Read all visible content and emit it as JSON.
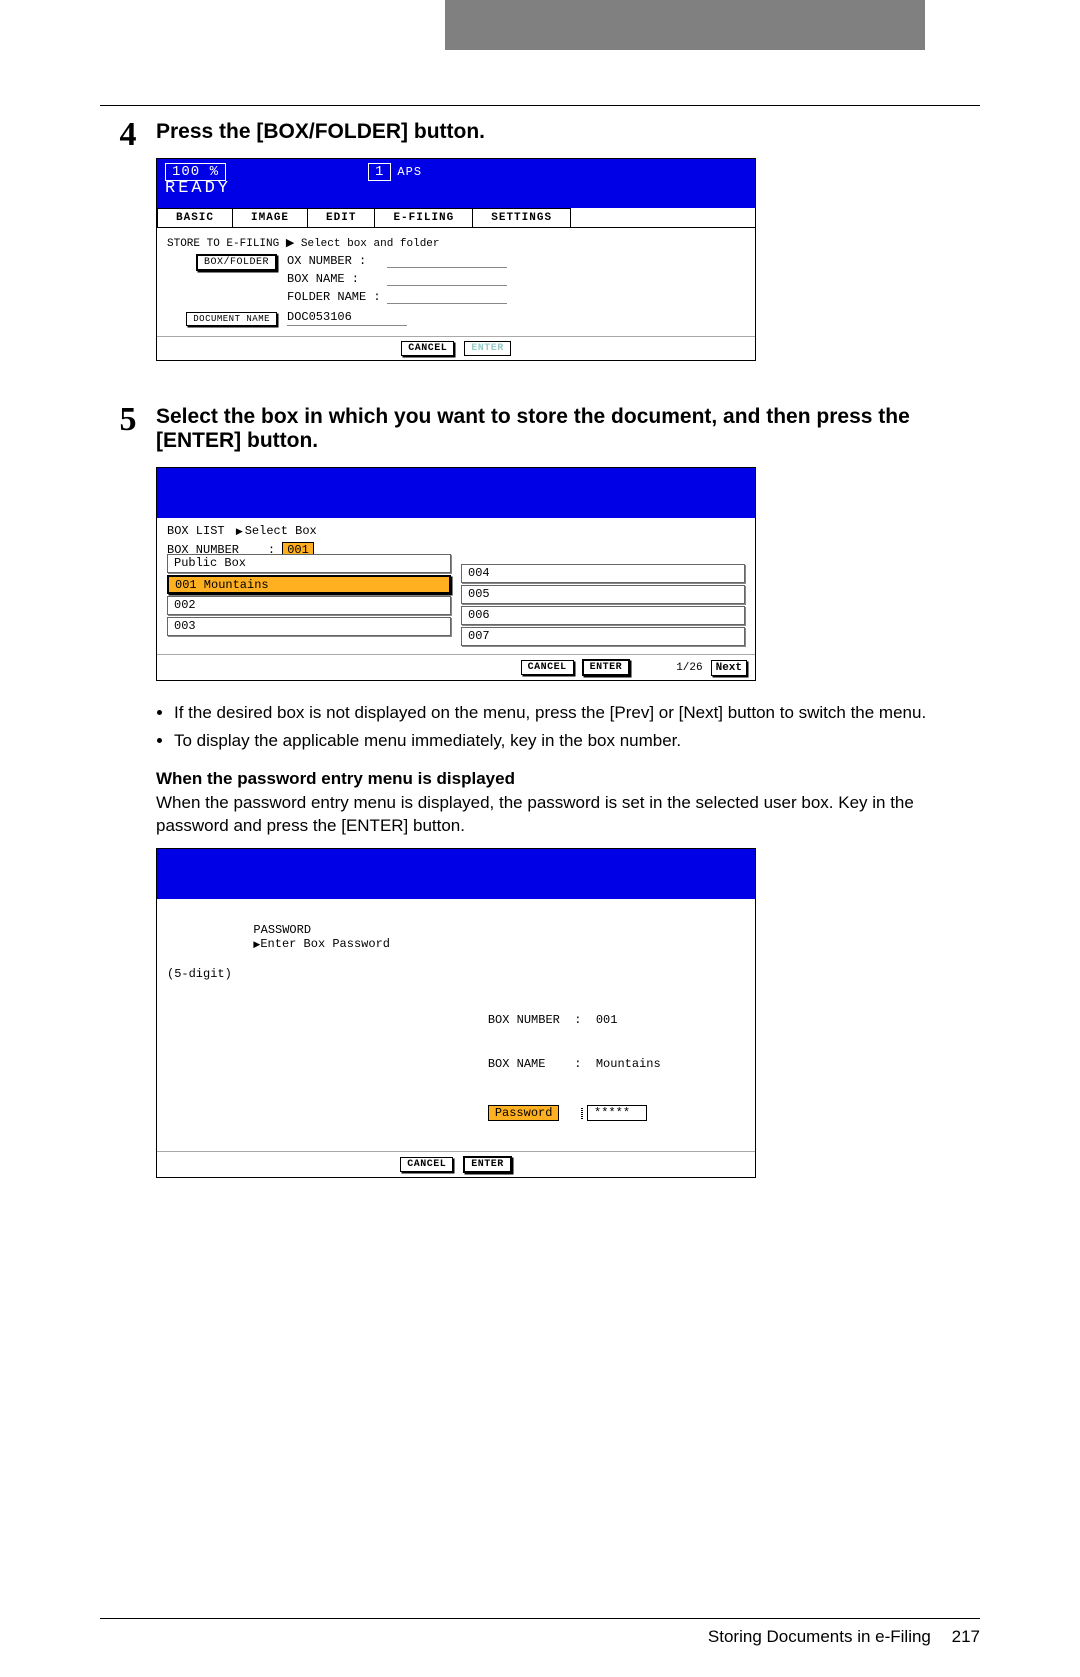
{
  "step4": {
    "num": "4",
    "title": "Press the [BOX/FOLDER] button.",
    "screen": {
      "percent": "100 %",
      "copies": "1",
      "mode": "APS",
      "ready": "READY",
      "tabs": [
        "BASIC",
        "IMAGE",
        "EDIT",
        "E-FILING",
        "SETTINGS"
      ],
      "storeLine": "STORE TO E-FILING ▶ Select box and folder",
      "boxFolderBtn": "BOX/FOLDER",
      "boxNumberLbl": "OX NUMBER  :",
      "boxNameLbl": "BOX NAME   :",
      "folderNameLbl": "FOLDER NAME :",
      "docNameBtn": "DOCUMENT NAME",
      "docNameVal": "DOC053106",
      "cancel": "CANCEL",
      "enter": "ENTER"
    }
  },
  "step5": {
    "num": "5",
    "title": "Select the box in which you want to store the document, and then press the [ENTER] button.",
    "screen": {
      "listLabel": "BOX LIST",
      "crumb": "Select Box",
      "boxNumLabel": "BOX NUMBER",
      "boxNumVal": "001",
      "left": [
        "Public Box",
        "001 Mountains",
        "002",
        "003"
      ],
      "right": [
        "004",
        "005",
        "006",
        "007"
      ],
      "selectedIndex": 1,
      "cancel": "CANCEL",
      "enter": "ENTER",
      "page": "1/26",
      "next": "Next"
    },
    "bullets": [
      "If the desired box is not displayed on the menu, press the [Prev] or [Next] button to switch the menu.",
      "To display the applicable menu immediately, key in the box number."
    ],
    "pwHeading": "When the password entry menu is displayed",
    "pwPara": "When the password entry menu is displayed, the password is set in the selected user box. Key in the password and press the [ENTER] button.",
    "pwScreen": {
      "title": "PASSWORD",
      "crumb": "Enter Box Password",
      "hint": "(5-digit)",
      "boxNumberLbl": "BOX NUMBER",
      "boxNumberVal": "001",
      "boxNameLbl": "BOX NAME",
      "boxNameVal": "Mountains",
      "pwLbl": "Password",
      "pwVal": "*****",
      "cancel": "CANCEL",
      "enter": "ENTER"
    }
  },
  "footer": {
    "section": "Storing Documents in e-Filing",
    "page": "217"
  }
}
